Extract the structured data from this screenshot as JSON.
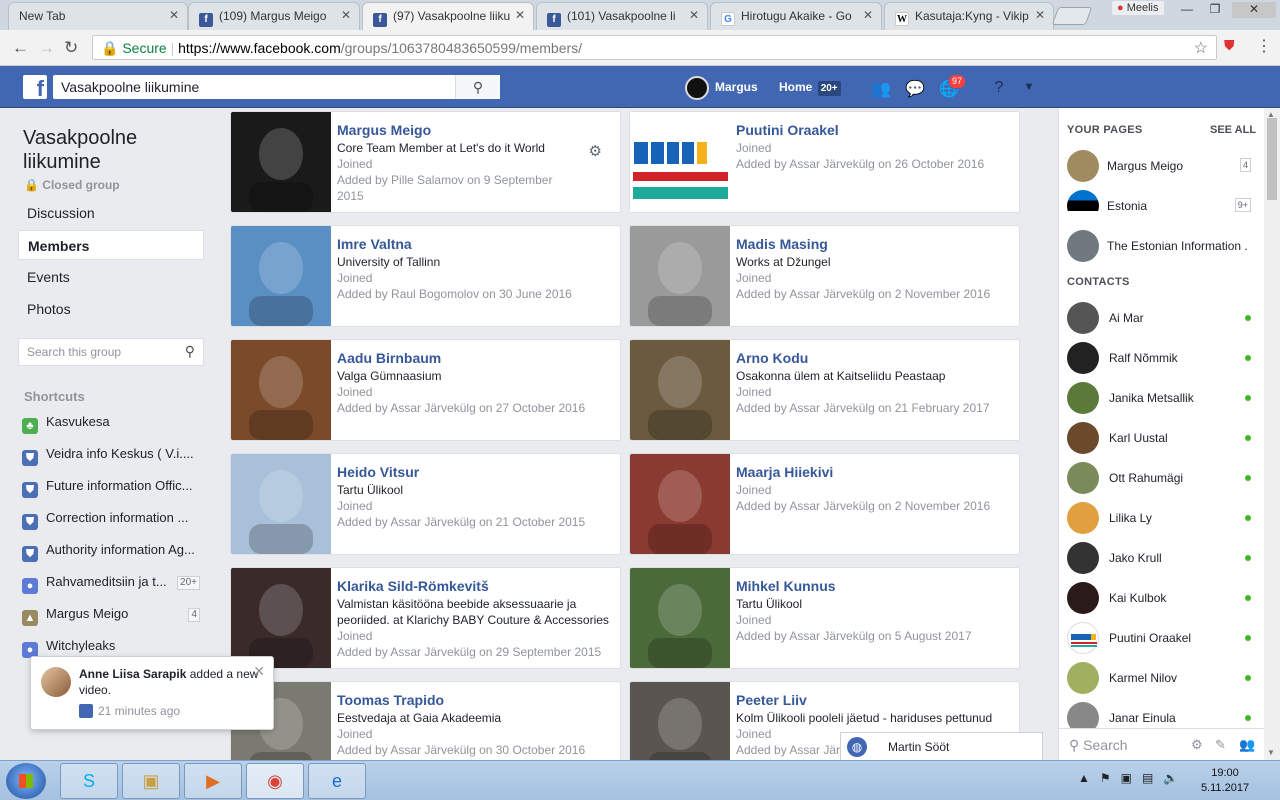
{
  "browser": {
    "tabs": [
      {
        "title": "New Tab",
        "favicon": "blank"
      },
      {
        "title": "(109) Margus Meigo",
        "favicon": "facebook"
      },
      {
        "title": "(97) Vasakpoolne liiku",
        "favicon": "facebook",
        "active": true
      },
      {
        "title": "(101) Vasakpoolne li",
        "favicon": "facebook"
      },
      {
        "title": "Hirotugu Akaike - Go",
        "favicon": "google"
      },
      {
        "title": "Kasutaja:Kyng - Vikip",
        "favicon": "wikipedia"
      }
    ],
    "window_user": "Meelis",
    "secure_label": "Secure",
    "url_host": "https://www.facebook.com",
    "url_path": "/groups/1063780483650599/members/"
  },
  "fb": {
    "search_value": "Vasakpoolne liikumine",
    "user_name": "Margus",
    "home_label": "Home",
    "home_count": "20+",
    "notif_count": "97"
  },
  "group": {
    "title": "Vasakpoolne liikumine",
    "privacy": "Closed group",
    "nav": [
      "Discussion",
      "Members",
      "Events",
      "Photos"
    ],
    "search_placeholder": "Search this group"
  },
  "shortcuts": {
    "heading": "Shortcuts",
    "items": [
      {
        "label": "Kasvukesa",
        "icon": "tree-icon"
      },
      {
        "label": "Veidra info Keskus ( V.i....",
        "icon": "shield-icon"
      },
      {
        "label": "Future information Offic...",
        "icon": "shield-icon"
      },
      {
        "label": "Correction information ...",
        "icon": "shield-icon"
      },
      {
        "label": "Authority information Ag...",
        "icon": "shield-icon"
      },
      {
        "label": "Rahvameditsiin ja t...",
        "icon": "group-icon",
        "badge": "20+"
      },
      {
        "label": "Margus Meigo",
        "icon": "page-icon",
        "badge": "4"
      },
      {
        "label": "Witchyleaks",
        "icon": "group-icon"
      }
    ]
  },
  "members": [
    {
      "name": "Margus Meigo",
      "line1": "Core Team Member at Let's do it World",
      "joined": "Joined",
      "added": "Added by Pille Salamov on 9 September 2015",
      "photo": "#1a1a1a"
    },
    {
      "name": "Puutini Oraakel",
      "line1": "",
      "joined": "Joined",
      "added": "Added by Assar Järvekülg on 26 October 2016",
      "photo": "delfi"
    },
    {
      "name": "Imre Valtna",
      "line1": "University of Tallinn",
      "joined": "Joined",
      "added": "Added by Raul Bogomolov on 30 June 2016",
      "photo": "#5a8fc4"
    },
    {
      "name": "Madis Masing",
      "line1": "Works at Džungel",
      "joined": "Joined",
      "added": "Added by Assar Järvekülg on 2 November 2016",
      "photo": "#9a9a9a"
    },
    {
      "name": "Aadu Birnbaum",
      "line1": "Valga Gümnaasium",
      "joined": "Joined",
      "added": "Added by Assar Järvekülg on 27 October 2016",
      "photo": "#7a4a2a"
    },
    {
      "name": "Arno Kodu",
      "line1": "Osakonna ülem at Kaitseliidu Peastaap",
      "joined": "Joined",
      "added": "Added by Assar Järvekülg on 21 February 2017",
      "photo": "#6b5a40"
    },
    {
      "name": "Heido Vitsur",
      "line1": "Tartu Ülikool",
      "joined": "Joined",
      "added": "Added by Assar Järvekülg on 21 October 2015",
      "photo": "#a8c0d8"
    },
    {
      "name": "Maarja Hiiekivi",
      "line1": "",
      "joined": "Joined",
      "added": "Added by Assar Järvekülg on 2 November 2016",
      "photo": "#8a3a30"
    },
    {
      "name": "Klarika Sild-Römkevitš",
      "line1": "Valmistan käsitööna beebide aksessuaarie ja peoriided. at Klarichy BABY Couture & Accessories",
      "joined": "Joined",
      "added": "Added by Assar Järvekülg on 29 September 2015",
      "photo": "#3a2a2a"
    },
    {
      "name": "Mihkel Kunnus",
      "line1": "Tartu Ülikool",
      "joined": "Joined",
      "added": "Added by Assar Järvekülg on 5 August 2017",
      "photo": "#4a6a3a"
    },
    {
      "name": "Toomas Trapido",
      "line1": "Eestvedaja at Gaia Akadeemia",
      "joined": "Joined",
      "added": "Added by Assar Järvekülg on 30 October 2016",
      "photo": "#7a7a70"
    },
    {
      "name": "Peeter Liiv",
      "line1": "Kolm Ülikooli pooleli jäetud - hariduses pettunud",
      "joined": "Joined",
      "added": "Added by Assar Järvekülg on",
      "photo": "#5a5550"
    }
  ],
  "right": {
    "pages_heading": "YOUR PAGES",
    "see_all": "SEE ALL",
    "pages": [
      {
        "name": "Margus Meigo",
        "badge": "4",
        "color": "#a08a60"
      },
      {
        "name": "Estonia",
        "badge": "9+",
        "color": "#0072ce"
      },
      {
        "name": "The Estonian Information ...",
        "badge": "",
        "color": "#707880"
      }
    ],
    "contacts_heading": "CONTACTS",
    "contacts": [
      {
        "name": "Ai Mar",
        "color": "#555"
      },
      {
        "name": "Ralf Nõmmik",
        "color": "#222"
      },
      {
        "name": "Janika Metsallik",
        "color": "#5a7a3a"
      },
      {
        "name": "Karl Uustal",
        "color": "#6a4a2a"
      },
      {
        "name": "Ott Rahumägi",
        "color": "#7a8a5a"
      },
      {
        "name": "Lilika Ly",
        "color": "#e0a040"
      },
      {
        "name": "Jako Krull",
        "color": "#333"
      },
      {
        "name": "Kai Kulbok",
        "color": "#2a1a1a"
      },
      {
        "name": "Puutini Oraakel",
        "color": "delfi"
      },
      {
        "name": "Karmel Nilov",
        "color": "#a0b060"
      },
      {
        "name": "Janar Einula",
        "color": "#888"
      }
    ],
    "chat_search": "Search"
  },
  "chat_tab": {
    "name": "Martin Sööt"
  },
  "notification": {
    "actor": "Anne Liisa Sarapik",
    "action": "added a new video.",
    "time": "21 minutes ago"
  },
  "taskbar": {
    "apps": [
      "skype-icon",
      "explorer-icon",
      "media-player-icon",
      "chrome-icon",
      "ie-icon"
    ],
    "time": "19:00",
    "date": "5.11.2017"
  }
}
